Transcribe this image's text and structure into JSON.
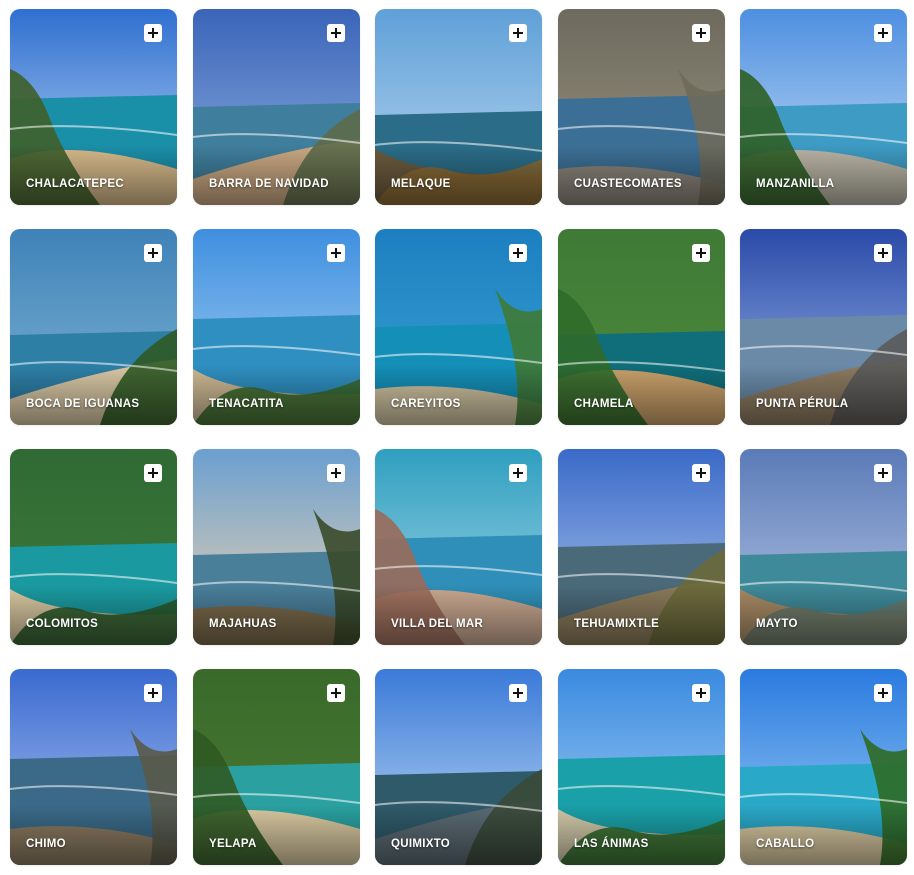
{
  "add_icon": "plus-icon",
  "destinations": [
    {
      "slug": "chalacatepec",
      "label": "CHALACATEPEC",
      "sky": [
        "#2f6fd0",
        "#bcd8f4"
      ],
      "sea": "#1a8fa8",
      "land": "#d6b98a",
      "green": "#3f5f2a"
    },
    {
      "slug": "barra-de-navidad",
      "label": "BARRA DE NAVIDAD",
      "sky": [
        "#3a64b8",
        "#8fb2e2"
      ],
      "sea": "#3f7e9c",
      "land": "#c9a882",
      "green": "#5d6b4a"
    },
    {
      "slug": "melaque",
      "label": "MELAQUE",
      "sky": [
        "#5fa0d8",
        "#b8d6ee"
      ],
      "sea": "#2b6d88",
      "land": "#6b5a3e",
      "green": "#8b6a34"
    },
    {
      "slug": "cuastecomates",
      "label": "CUASTECOMATES",
      "sky": [
        "#6d6a5e",
        "#9a937e"
      ],
      "sea": "#3c6f95",
      "land": "#8a847a",
      "green": "#6e6a5a"
    },
    {
      "slug": "manzanilla",
      "label": "MANZANILLA",
      "sky": [
        "#4d8fe0",
        "#c9e0f6"
      ],
      "sea": "#3e9bc4",
      "land": "#b9b4a5",
      "green": "#2f5f26"
    },
    {
      "slug": "boca-de-iguanas",
      "label": "BOCA DE IGUANAS",
      "sky": [
        "#3f82b8",
        "#7fb4d4"
      ],
      "sea": "#2d7fa6",
      "land": "#d8c7a4",
      "green": "#2f5a25"
    },
    {
      "slug": "tenacatita",
      "label": "TENACATITA",
      "sky": [
        "#3f8fe0",
        "#a8d2f2"
      ],
      "sea": "#2f8fc0",
      "land": "#cdb894",
      "green": "#3a6a2c"
    },
    {
      "slug": "careyitos",
      "label": "CAREYITOS",
      "sky": [
        "#1c7fc0",
        "#3aa3d4"
      ],
      "sea": "#148fb8",
      "land": "#cfc2a0",
      "green": "#3f7a36"
    },
    {
      "slug": "chamela",
      "label": "CHAMELA",
      "sky": [
        "#3f7a36",
        "#4f8a3c"
      ],
      "sea": "#0f6e7a",
      "land": "#c9a06a",
      "green": "#2f6a2a"
    },
    {
      "slug": "punta-perula",
      "label": "PUNTA PÉRULA",
      "sky": [
        "#2a4aa8",
        "#9cb6e8"
      ],
      "sea": "#6a8aa8",
      "land": "#8c7a60",
      "green": "#5a5a5a"
    },
    {
      "slug": "colomitos",
      "label": "COLOMITOS",
      "sky": [
        "#2f6a34",
        "#3f7a3c"
      ],
      "sea": "#1a9aa0",
      "land": "#d8c7a0",
      "green": "#2a5a2a"
    },
    {
      "slug": "majahuas",
      "label": "MAJAHUAS",
      "sky": [
        "#6a9fd0",
        "#f0d6b0"
      ],
      "sea": "#4a7f9a",
      "land": "#7a6a4a",
      "green": "#3a4a2a"
    },
    {
      "slug": "villa-del-mar",
      "label": "VILLA DEL MAR",
      "sky": [
        "#2f9fc0",
        "#a8d8e8"
      ],
      "sea": "#2f8fb8",
      "land": "#c9a890",
      "green": "#9a6a5a"
    },
    {
      "slug": "tehuamixtle",
      "label": "TEHUAMIXTLE",
      "sky": [
        "#3a6ac8",
        "#b0c8ec"
      ],
      "sea": "#4a6a7a",
      "land": "#8a7a5a",
      "green": "#6a6a3a"
    },
    {
      "slug": "mayto",
      "label": "MAYTO",
      "sky": [
        "#5a7ab8",
        "#b8c8e4"
      ],
      "sea": "#3f8a9a",
      "land": "#a88a64",
      "green": "#6a7a6a"
    },
    {
      "slug": "chimo",
      "label": "CHIMO",
      "sky": [
        "#3a6ad0",
        "#b0c8f0"
      ],
      "sea": "#3a6a88",
      "land": "#8a7a60",
      "green": "#5a5a4a"
    },
    {
      "slug": "yelapa",
      "label": "YELAPA",
      "sky": [
        "#3a6a2a",
        "#4a7a32"
      ],
      "sea": "#2aa0a0",
      "land": "#d8c8a0",
      "green": "#2f5a22"
    },
    {
      "slug": "quimixto",
      "label": "QUIMIXTO",
      "sky": [
        "#3a7ad8",
        "#c0daf4"
      ],
      "sea": "#2f5a6a",
      "land": "#5a6a72",
      "green": "#3a4a3a"
    },
    {
      "slug": "las-animas",
      "label": "LAS ÁNIMAS",
      "sky": [
        "#3a8ae0",
        "#a8d2f4"
      ],
      "sea": "#1aa0a8",
      "land": "#d0c8a8",
      "green": "#2f6a2a"
    },
    {
      "slug": "caballo",
      "label": "CABALLO",
      "sky": [
        "#2a7ae0",
        "#9ed0f4"
      ],
      "sea": "#2aa8c8",
      "land": "#d8c8a0",
      "green": "#2f6a24"
    }
  ]
}
